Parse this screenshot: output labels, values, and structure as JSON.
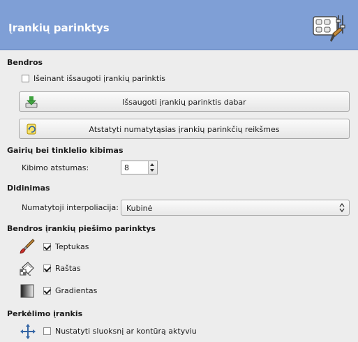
{
  "header": {
    "title": "Įrankių parinktys"
  },
  "general": {
    "title": "Bendros",
    "save_on_exit_label": "Išeinant išsaugoti įrankių parinktis",
    "save_on_exit_checked": false,
    "save_now_button": "Išsaugoti įrankių parinktis dabar",
    "reset_button": "Atstatyti numatytąsias įrankių parinkčių reikšmes"
  },
  "snap": {
    "title": "Gairių bei tinklelio kibimas",
    "distance_label": "Kibimo atstumas:",
    "distance_value": "8"
  },
  "scaling": {
    "title": "Didinimas",
    "interpolation_label": "Numatytoji interpoliacija:",
    "interpolation_value": "Kubinė"
  },
  "paint": {
    "title": "Bendros įrankių piešimo parinktys",
    "brush_label": "Teptukas",
    "brush_checked": true,
    "pattern_label": "Raštas",
    "pattern_checked": true,
    "gradient_label": "Gradientas",
    "gradient_checked": true
  },
  "move": {
    "title": "Perkėlimo įrankis",
    "set_active_label": "Nustatyti sluoksnį ar kontūrą aktyviu",
    "set_active_checked": false
  },
  "icons": {
    "header": "tool-options-icon",
    "save": "save-download-icon",
    "reset": "reset-icon",
    "brush": "paintbrush-icon",
    "pattern": "pattern-bucket-icon",
    "gradient": "gradient-icon",
    "move": "move-arrows-icon"
  },
  "colors": {
    "header_bg": "#7f9fd6",
    "header_text": "#ffffff",
    "window_bg": "#ededed"
  }
}
